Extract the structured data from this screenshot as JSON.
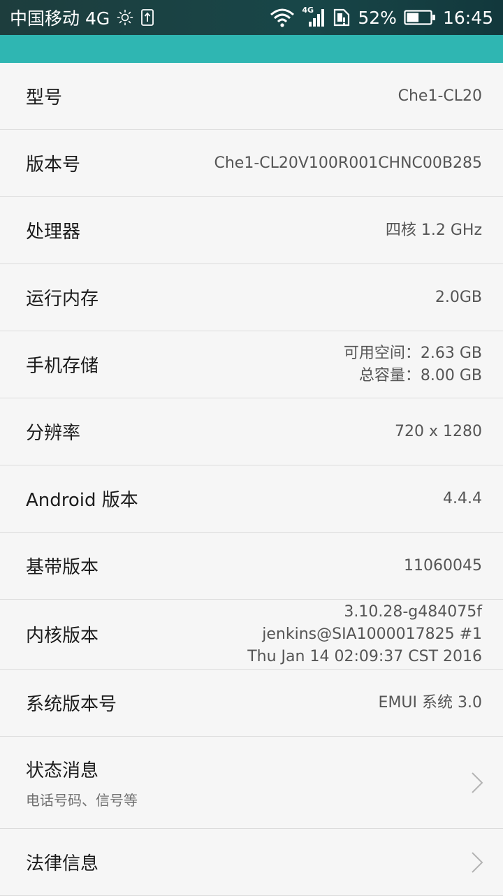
{
  "status_bar": {
    "carrier": "中国移动 4G",
    "network_badge": "4G",
    "battery_percent": "52%",
    "battery_level": 0.52,
    "time": "16:45",
    "icons": [
      "brightness-icon",
      "usb-icon",
      "wifi-icon",
      "signal-icon",
      "sim-alert-icon",
      "battery-icon"
    ]
  },
  "colors": {
    "action_bar": "#2fb6b2",
    "status_bar": "#184648",
    "background": "#f6f6f6",
    "divider": "#dcdcdc"
  },
  "items": {
    "model": {
      "label": "型号",
      "value": "Che1-CL20"
    },
    "build": {
      "label": "版本号",
      "value": "Che1-CL20V100R001CHNC00B285"
    },
    "processor": {
      "label": "处理器",
      "value": "四核 1.2 GHz"
    },
    "ram": {
      "label": "运行内存",
      "value": "2.0GB"
    },
    "storage": {
      "label": "手机存储",
      "available": "可用空间：2.63 GB",
      "total": "总容量：8.00 GB"
    },
    "resolution": {
      "label": "分辨率",
      "value": "720 x 1280"
    },
    "android": {
      "label": "Android 版本",
      "value": "4.4.4"
    },
    "baseband": {
      "label": "基带版本",
      "value": "11060045"
    },
    "kernel": {
      "label": "内核版本",
      "lines": [
        "3.10.28-g484075f",
        "jenkins@SIA1000017825 #1",
        "Thu Jan 14 02:09:37 CST 2016"
      ]
    },
    "system": {
      "label": "系统版本号",
      "value": "EMUI 系统 3.0"
    },
    "status": {
      "label": "状态消息",
      "subtitle": "电话号码、信号等"
    },
    "legal": {
      "label": "法律信息"
    }
  }
}
